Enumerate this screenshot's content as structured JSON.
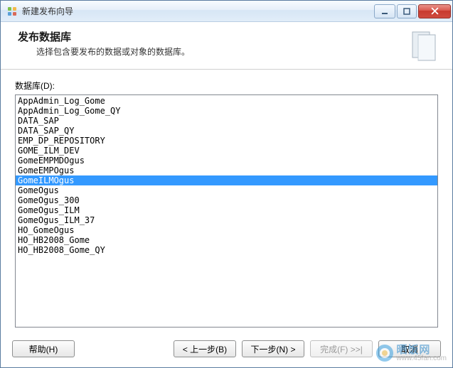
{
  "window": {
    "title": "新建发布向导"
  },
  "header": {
    "title": "发布数据库",
    "subtitle": "选择包含要发布的数据或对象的数据库。"
  },
  "list": {
    "label": "数据库(D):",
    "selected_index": 8,
    "items": [
      "AppAdmin_Log_Gome",
      "AppAdmin_Log_Gome_QY",
      "DATA_SAP",
      "DATA_SAP_QY",
      "EMP_DP_REPOSITORY",
      "GOME_ILM_DEV",
      "GomeEMPMDOgus",
      "GomeEMPOgus",
      "GomeILMOgus",
      "GomeOgus",
      "GomeOgus_300",
      "GomeOgus_ILM",
      "GomeOgus_ILM_37",
      "HO_GomeOgus",
      "HO_HB2008_Gome",
      "HO_HB2008_Gome_QY"
    ]
  },
  "buttons": {
    "help": "帮助(H)",
    "back": "< 上一步(B)",
    "next": "下一步(N) >",
    "finish": "完成(F) >>|",
    "cancel": "取消"
  },
  "watermark": {
    "top": "晒饭网",
    "bottom": "www.45fan.com"
  }
}
